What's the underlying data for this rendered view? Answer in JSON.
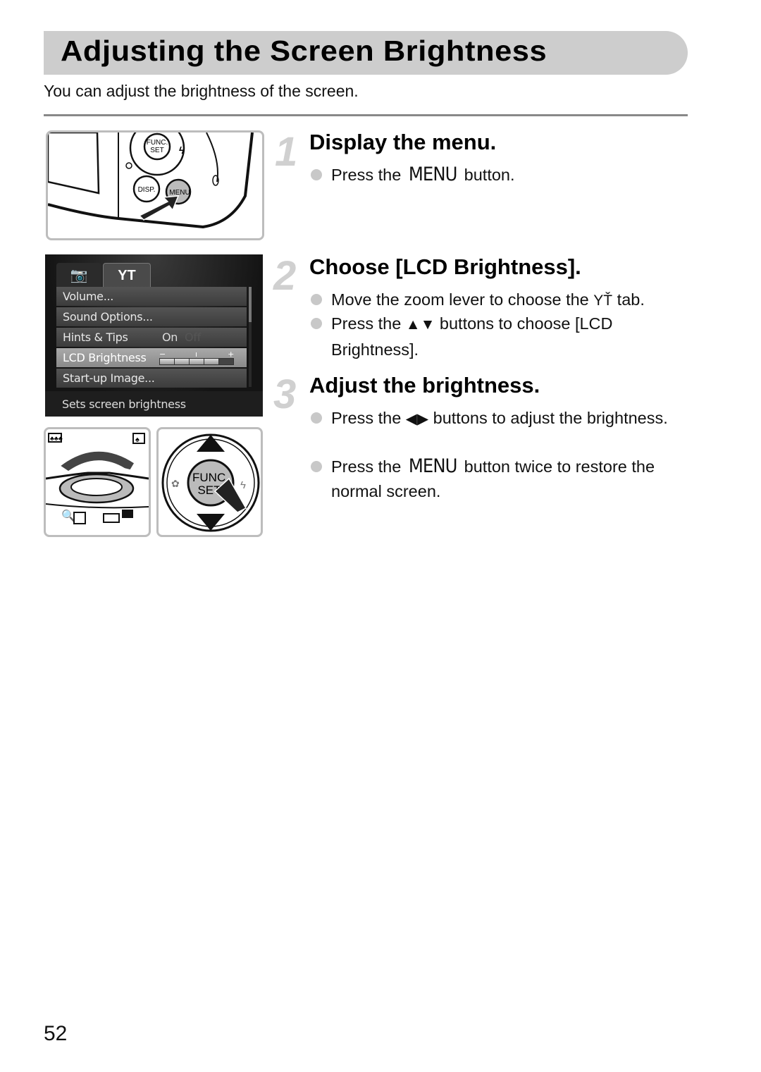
{
  "header": {
    "title": "Adjusting the Screen Brightness",
    "intro": "You can adjust the brightness of the screen."
  },
  "steps": [
    {
      "number": "1",
      "title": "Display the menu.",
      "bullets": [
        {
          "pre": "Press the ",
          "key": "MENU",
          "post": " button."
        }
      ]
    },
    {
      "number": "2",
      "title": "Choose [LCD Brightness].",
      "bullets": [
        {
          "pre": "Move the zoom lever to choose the ",
          "icon": "settings-tab-icon",
          "icon_glyph": "🔧",
          "post": " tab."
        },
        {
          "pre": "Press the ",
          "icon": "up-down-arrows-icon",
          "icon_glyph": "▲▼",
          "post": " buttons to choose [LCD Brightness]."
        }
      ]
    },
    {
      "number": "3",
      "title": "Adjust the brightness.",
      "bullets": [
        {
          "pre": "Press the ",
          "icon": "left-right-arrows-icon",
          "icon_glyph": "◀▶",
          "post": " buttons to adjust the brightness."
        },
        {
          "pre": "Press the ",
          "key": "MENU",
          "post": " button twice to restore the normal screen."
        }
      ]
    }
  ],
  "figures": {
    "camera_back": {
      "labels": {
        "func_set": "FUNC. SET",
        "disp": "DISP.",
        "menu": "MENU"
      }
    },
    "lcd_menu": {
      "tabs": [
        {
          "icon": "camera-icon",
          "glyph": "●",
          "active": false
        },
        {
          "icon": "settings-tab-icon",
          "glyph": "YT",
          "active": true
        }
      ],
      "items": [
        {
          "label": "Volume..."
        },
        {
          "label": "Sound Options..."
        },
        {
          "label": "Hints & Tips",
          "value_on": "On",
          "value_off": "Off"
        },
        {
          "label": "LCD Brightness",
          "selected": true,
          "level": 4,
          "max_level": 5,
          "min_mark": "−",
          "max_mark": "+"
        },
        {
          "label": "Start-up Image..."
        }
      ],
      "help_text": "Sets screen brightness"
    },
    "zoom_lever": {
      "wide_icon": "wide-icon",
      "tele_icon": "tele-icon"
    },
    "control_dial": {
      "center_label": "FUNC. SET"
    }
  },
  "page_number": "52"
}
